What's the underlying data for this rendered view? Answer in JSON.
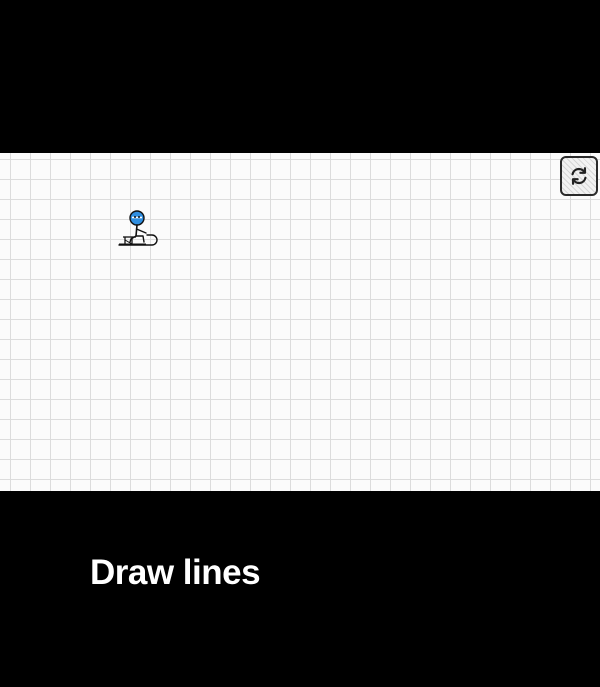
{
  "caption": {
    "text": "Draw lines"
  },
  "game": {
    "restart_icon": "restart-icon",
    "character_icon": "stickman-on-sled-icon",
    "colors": {
      "background": "#000000",
      "paper": "#fbfbfb",
      "grid_line": "#dcdcdc",
      "character_head": "#2f8ee0",
      "caption_text": "#ffffff"
    }
  }
}
